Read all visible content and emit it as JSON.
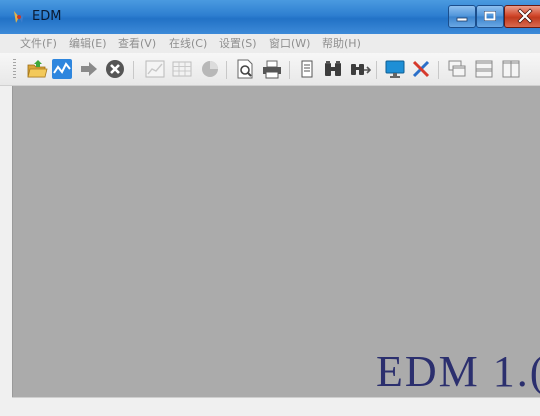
{
  "window": {
    "title": "EDM"
  },
  "menu": {
    "items": [
      {
        "label": "文件(F)"
      },
      {
        "label": "编辑(E)"
      },
      {
        "label": "查看(V)"
      },
      {
        "label": "在线(C)"
      },
      {
        "label": "设置(S)"
      },
      {
        "label": "窗口(W)"
      },
      {
        "label": "帮助(H)"
      }
    ]
  },
  "toolbar": {
    "buttons": [
      {
        "icon": "open-folder-icon",
        "enabled": true
      },
      {
        "icon": "waveform-icon",
        "enabled": true
      },
      {
        "icon": "arrow-right-icon",
        "enabled": true
      },
      {
        "icon": "stop-icon",
        "enabled": true
      },
      {
        "icon": "line-chart-icon",
        "enabled": false
      },
      {
        "icon": "table-icon",
        "enabled": false
      },
      {
        "icon": "pie-chart-icon",
        "enabled": false
      },
      {
        "icon": "print-preview-icon",
        "enabled": true
      },
      {
        "icon": "print-icon",
        "enabled": true
      },
      {
        "icon": "document-icon",
        "enabled": true
      },
      {
        "icon": "binoculars-icon",
        "enabled": true
      },
      {
        "icon": "find-next-icon",
        "enabled": true
      },
      {
        "icon": "monitor-icon",
        "enabled": true
      },
      {
        "icon": "tools-icon",
        "enabled": true
      },
      {
        "icon": "cascade-windows-icon",
        "enabled": true
      },
      {
        "icon": "tile-horizontal-icon",
        "enabled": true
      },
      {
        "icon": "tile-vertical-icon",
        "enabled": true
      }
    ]
  },
  "workspace": {
    "splash_text": "EDM 1.("
  },
  "colors": {
    "titlebar": "#2e7fd0",
    "workspace": "#ababab",
    "splash_text": "#2b2f6e",
    "menu_text_disabled": "#8f8f8f"
  }
}
